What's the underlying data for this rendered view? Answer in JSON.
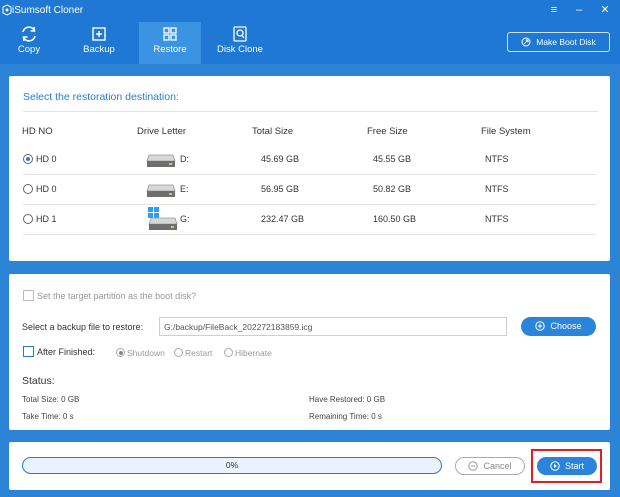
{
  "window": {
    "title": "iSumsoft Cloner",
    "controls": [
      "≡",
      "–",
      "✕"
    ]
  },
  "toolbar": {
    "tabs": [
      {
        "label": "Copy",
        "icon": "copy-icon",
        "active": false
      },
      {
        "label": "Backup",
        "icon": "backup-icon",
        "active": false
      },
      {
        "label": "Restore",
        "icon": "restore-icon",
        "active": true
      },
      {
        "label": "Disk Clone",
        "icon": "disk-clone-icon",
        "active": false
      }
    ],
    "boot_disk_label": "Make Boot Disk"
  },
  "destination": {
    "heading": "Select the restoration destination:",
    "columns": [
      "HD NO",
      "Drive Letter",
      "Total Size",
      "Free Size",
      "File System"
    ],
    "rows": [
      {
        "hd": "HD 0",
        "letter": "D:",
        "total": "45.69 GB",
        "free": "45.55 GB",
        "fs": "NTFS",
        "selected": true,
        "icon": "hard-drive-icon"
      },
      {
        "hd": "HD 0",
        "letter": "E:",
        "total": "56.95 GB",
        "free": "50.82 GB",
        "fs": "NTFS",
        "selected": false,
        "icon": "hard-drive-icon"
      },
      {
        "hd": "HD 1",
        "letter": "G:",
        "total": "232.47 GB",
        "free": "160.50 GB",
        "fs": "NTFS",
        "selected": false,
        "icon": "windows-drive-icon"
      }
    ]
  },
  "options": {
    "boot_disk_checkbox": "Set the target partition as the boot disk?",
    "backup_file_label": "Select a backup file to restore:",
    "backup_file_value": "G:/backup/FileBack_202272183859.icg",
    "choose_label": "Choose",
    "after_finished_label": "After Finished:",
    "after_actions": [
      "Shutdown",
      "Restart",
      "Hibernate"
    ]
  },
  "status": {
    "heading": "Status:",
    "total_size": "Total Size: 0 GB",
    "have_restored": "Have Restored: 0 GB",
    "take_time": "Take Time: 0 s",
    "remaining_time": "Remaining Time: 0 s"
  },
  "footer": {
    "progress_text": "0%",
    "progress_value": 0,
    "cancel_label": "Cancel",
    "start_label": "Start"
  },
  "colors": {
    "accent": "#2a84dc",
    "titlebar": "#1e78d4",
    "highlight": "#e02020"
  }
}
